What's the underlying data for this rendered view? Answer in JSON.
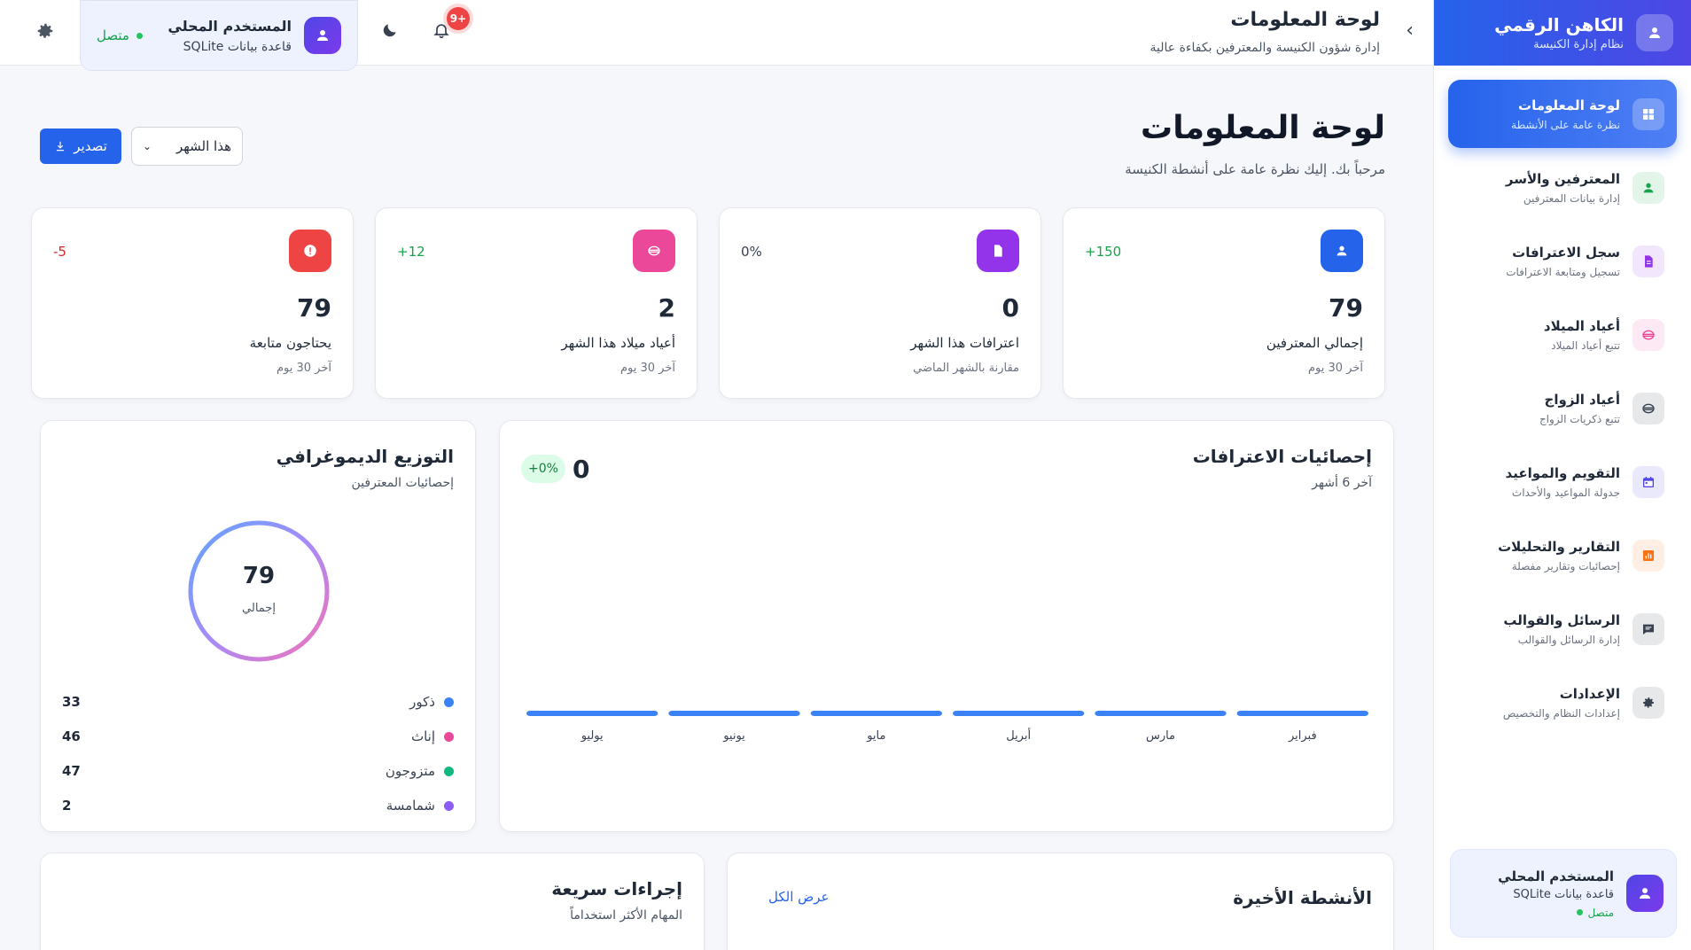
{
  "sidebar": {
    "brand_title": "الكاهن الرقمي",
    "brand_subtitle": "نظام إدارة الكنيسة",
    "items": [
      {
        "label": "لوحة المعلومات",
        "sub": "نظرة عامة على الأنشطة",
        "icon": "dashboard-icon",
        "color": "#2563eb"
      },
      {
        "label": "المعترفين والأسر",
        "sub": "إدارة بيانات المعترفين",
        "icon": "user-icon",
        "color": "#16a34a"
      },
      {
        "label": "سجل الاعترافات",
        "sub": "تسجيل ومتابعة الاعترافات",
        "icon": "document-icon",
        "color": "#9333ea"
      },
      {
        "label": "أعياد الميلاد",
        "sub": "تتبع أعياد الميلاد",
        "icon": "cake-icon",
        "color": "#ec4899"
      },
      {
        "label": "أعياد الزواج",
        "sub": "تتبع ذكريات الزواج",
        "icon": "cake-icon",
        "color": "#374151"
      },
      {
        "label": "التقويم والمواعيد",
        "sub": "جدولة المواعيد والأحداث",
        "icon": "calendar-icon",
        "color": "#4f46e5"
      },
      {
        "label": "التقارير والتحليلات",
        "sub": "إحصائيات وتقارير مفصلة",
        "icon": "chart-icon",
        "color": "#f97316"
      },
      {
        "label": "الرسائل والقوالب",
        "sub": "إدارة الرسائل والقوالب",
        "icon": "message-icon",
        "color": "#374151"
      },
      {
        "label": "الإعدادات",
        "sub": "إعدادات النظام والتخصيص",
        "icon": "gear-icon",
        "color": "#374151"
      }
    ],
    "user": {
      "name": "المستخدم المحلي",
      "db": "قاعدة بيانات SQLite",
      "status": "متصل"
    }
  },
  "header": {
    "title": "لوحة المعلومات",
    "subtitle": "إدارة شؤون الكنيسة والمعترفين بكفاءة عالية",
    "user_name": "المستخدم المحلي",
    "user_db": "قاعدة بيانات SQLite",
    "status": "متصل",
    "notif_count": "+9"
  },
  "main": {
    "title": "لوحة المعلومات",
    "subtitle": "مرحباً بك. إليك نظرة عامة على أنشطة الكنيسة",
    "period": "هذا الشهر",
    "export_label": "تصدير"
  },
  "stats": [
    {
      "value": "79",
      "label": "إجمالي المعترفين",
      "note": "آخر 30 يوم",
      "change": "150+",
      "change_color": "#16a34a",
      "icon_bg": "#2563eb",
      "icon": "user-icon"
    },
    {
      "value": "0",
      "label": "اعترافات هذا الشهر",
      "note": "مقارنة بالشهر الماضي",
      "change": "0%",
      "change_color": "#374151",
      "icon_bg": "#9333ea",
      "icon": "document-icon"
    },
    {
      "value": "2",
      "label": "أعياد ميلاد هذا الشهر",
      "note": "آخر 30 يوم",
      "change": "12+",
      "change_color": "#16a34a",
      "icon_bg": "#ec4899",
      "icon": "cake-icon"
    },
    {
      "value": "79",
      "label": "يحتاجون متابعة",
      "note": "آخر 30 يوم",
      "change": "5-",
      "change_color": "#dc2626",
      "icon_bg": "#ef4444",
      "icon": "alert-icon"
    }
  ],
  "confessions": {
    "title": "إحصائيات الاعترافات",
    "subtitle": "آخر 6 أشهر",
    "total": "0",
    "change": "+0%"
  },
  "demographics": {
    "title": "التوزيع الديموغرافي",
    "subtitle": "إحصائيات المعترفين",
    "total": "79",
    "total_label": "إجمالي",
    "items": [
      {
        "label": "ذكور",
        "value": "33",
        "color": "#3b82f6"
      },
      {
        "label": "إناث",
        "value": "46",
        "color": "#ec4899"
      },
      {
        "label": "متزوجون",
        "value": "47",
        "color": "#10b981"
      },
      {
        "label": "شمامسة",
        "value": "2",
        "color": "#8b5cf6"
      }
    ]
  },
  "activities": {
    "title": "الأنشطة الأخيرة",
    "view_all": "عرض الكل"
  },
  "quick_actions": {
    "title": "إجراءات سريعة",
    "subtitle": "المهام الأكثر استخداماً"
  },
  "chart_data": {
    "type": "bar",
    "title": "إحصائيات الاعترافات",
    "categories": [
      "فبراير",
      "مارس",
      "أبريل",
      "مايو",
      "يونيو",
      "يوليو"
    ],
    "values": [
      0,
      0,
      0,
      0,
      0,
      0
    ],
    "xlabel": "",
    "ylabel": "",
    "grid": false,
    "color": "#3b82f6"
  }
}
